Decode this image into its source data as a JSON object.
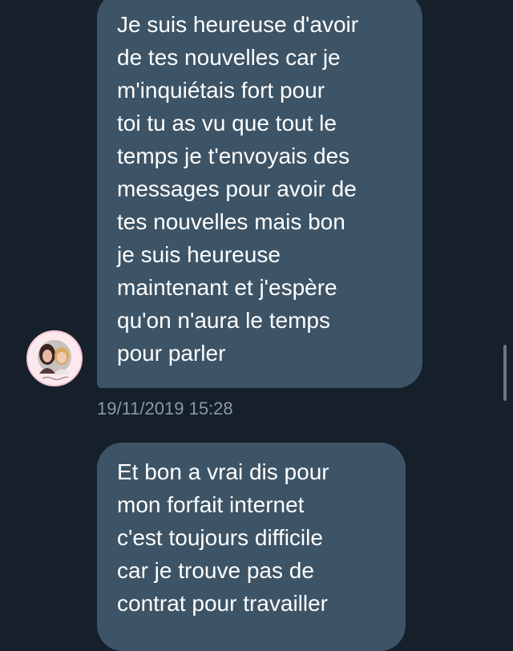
{
  "conversation": {
    "messages": [
      {
        "lines": [
          "Je suis heureuse d'avoir",
          "de tes nouvelles car je",
          "m'inquiétais fort pour",
          "toi tu as vu que tout le",
          "temps je t'envoyais des",
          "messages pour avoir de",
          "tes nouvelles mais bon",
          "je suis heureuse",
          "maintenant et j'espère",
          "qu'on n'aura le temps",
          "pour parler"
        ],
        "timestamp": "19/11/2019 15:28"
      },
      {
        "lines": [
          "Et bon a vrai dis pour",
          "mon forfait internet",
          "c'est toujours difficile",
          "car je trouve pas de",
          "contrat pour travailler"
        ]
      }
    ],
    "sender_avatar_icon": "profile-photo-icon"
  },
  "colors": {
    "background": "#15202b",
    "bubble": "#3d5466",
    "text": "#ffffff",
    "timestamp": "#8b98a5"
  }
}
